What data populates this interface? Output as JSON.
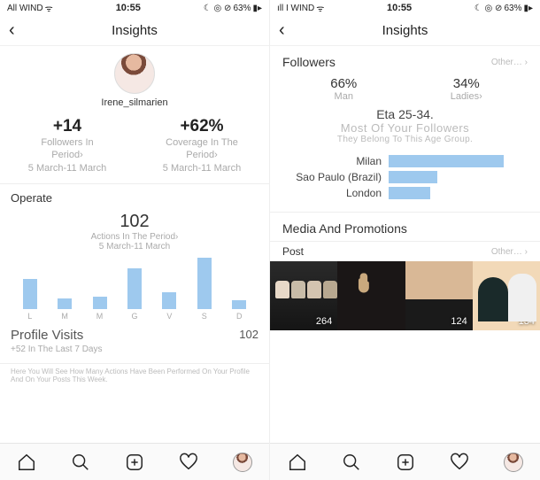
{
  "status": {
    "carrier_left": "All WIND",
    "carrier_right": "ıll I WIND",
    "time": "10:55",
    "battery": "63%",
    "icons": "☾ ◎ ⊘"
  },
  "header": {
    "title": "Insights"
  },
  "left": {
    "username": "Irene_silmarien",
    "stat1_value": "+14",
    "stat1_label1": "Followers In",
    "stat1_label2": "Period›",
    "stat1_label3": "5 March-11 March",
    "stat2_value": "+62%",
    "stat2_label1": "Coverage In The",
    "stat2_label2": "Period›",
    "stat2_label3": "5 March-11 March",
    "operate": "Operate",
    "actions_num": "102",
    "actions_sub1": "Actions In The Period›",
    "actions_sub2": "5 March-11 March",
    "pv_title": "Profile Visits",
    "pv_num": "102",
    "pv_sub": "+52 In The Last 7 Days",
    "footnote": "Here You Will See How Many Actions Have Been Performed On Your Profile And On Your Posts This Week."
  },
  "right": {
    "followers": "Followers",
    "other": "Other…  ›",
    "g1_pct": "66%",
    "g1_lbl": "Man",
    "g2_pct": "34%",
    "g2_lbl": "Ladies›",
    "age_title": "Eta 25-34.",
    "age_sub": "Most Of Your Followers",
    "age_note": "They Belong To This Age Group.",
    "city1": "Milan",
    "city2": "Sao Paulo (Brazil)",
    "city3": "London",
    "media": "Media And Promotions",
    "post": "Post",
    "post_other": "Other…  ›",
    "t1": "264",
    "t2": "124",
    "t3": "134"
  },
  "chart_data": {
    "type": "bar",
    "categories": [
      "L",
      "M",
      "M",
      "G",
      "V",
      "S",
      "D"
    ],
    "values": [
      14,
      5,
      6,
      19,
      8,
      24,
      4
    ],
    "title": "Actions In The Period",
    "ylim": [
      0,
      25
    ]
  },
  "city_data": {
    "type": "bar",
    "categories": [
      "Milan",
      "Sao Paulo (Brazil)",
      "London"
    ],
    "values": [
      100,
      42,
      36
    ]
  }
}
